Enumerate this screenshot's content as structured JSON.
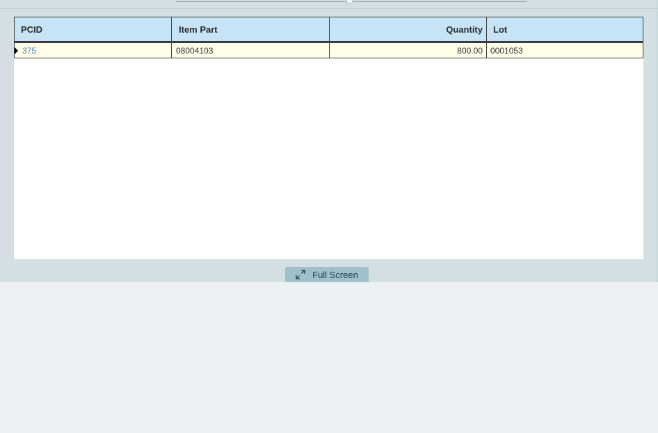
{
  "grid": {
    "columns": {
      "pcid": "PCID",
      "item_part": "Item Part",
      "quantity": "Quantity",
      "lot": "Lot"
    },
    "rows": [
      {
        "pcid": "375",
        "item_part": "08004103",
        "quantity": "800.00",
        "lot": "0001053"
      }
    ]
  },
  "footer": {
    "fullscreen_label": "Full Screen",
    "fullscreen_icon": "expand-arrows-icon"
  },
  "colors": {
    "panel_bg": "#d3dfe3",
    "header_bg": "#c6e4f5",
    "row_bg": "#fefde8",
    "button_bg": "#9ec0ca"
  }
}
